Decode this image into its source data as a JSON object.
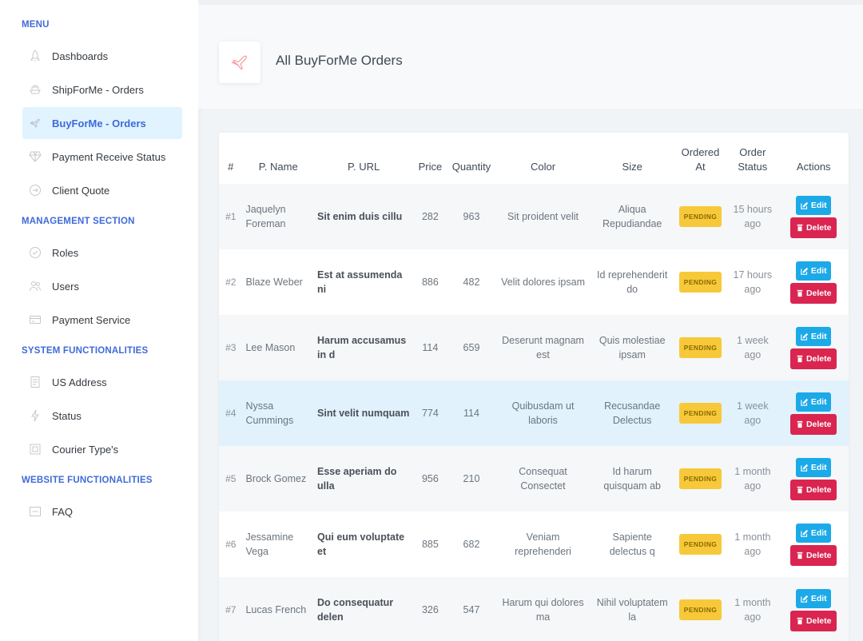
{
  "sidebar": {
    "sections": [
      {
        "heading": "MENU",
        "items": [
          {
            "label": "Dashboards",
            "icon": "rocket-icon",
            "active": false
          },
          {
            "label": "ShipForMe - Orders",
            "icon": "ship-icon",
            "active": false
          },
          {
            "label": "BuyForMe - Orders",
            "icon": "plane-icon",
            "active": true
          },
          {
            "label": "Payment Receive Status",
            "icon": "diamond-icon",
            "active": false
          },
          {
            "label": "Client Quote",
            "icon": "arrow-circle-icon",
            "active": false
          }
        ]
      },
      {
        "heading": "MANAGEMENT SECTION",
        "items": [
          {
            "label": "Roles",
            "icon": "check-circle-icon",
            "active": false
          },
          {
            "label": "Users",
            "icon": "users-icon",
            "active": false
          },
          {
            "label": "Payment Service",
            "icon": "credit-card-icon",
            "active": false
          }
        ]
      },
      {
        "heading": "SYSTEM FUNCTIONALITIES",
        "items": [
          {
            "label": "US Address",
            "icon": "document-icon",
            "active": false
          },
          {
            "label": "Status",
            "icon": "lightning-icon",
            "active": false
          },
          {
            "label": "Courier Type's",
            "icon": "box-icon",
            "active": false
          }
        ]
      },
      {
        "heading": "WEBSITE FUNCTIONALITIES",
        "items": [
          {
            "label": "FAQ",
            "icon": "list-box-icon",
            "active": false
          }
        ]
      }
    ]
  },
  "header": {
    "title": "All BuyForMe Orders",
    "icon": "plane-icon"
  },
  "table": {
    "columns": [
      "#",
      "P. Name",
      "P. URL",
      "Price",
      "Quantity",
      "Color",
      "Size",
      "Ordered At",
      "Order Status",
      "Actions"
    ],
    "edit_label": "Edit",
    "delete_label": "Delete",
    "rows": [
      {
        "num": "#1",
        "name": "Jaquelyn Foreman",
        "url": "Sit enim duis cillu",
        "price": "282",
        "quantity": "963",
        "color": "Sit proident velit",
        "size": "Aliqua Repudiandae",
        "status": "PENDING",
        "time": "15 hours ago"
      },
      {
        "num": "#2",
        "name": "Blaze Weber",
        "url": "Est at assumenda ni",
        "price": "886",
        "quantity": "482",
        "color": "Velit dolores ipsam",
        "size": "Id reprehenderit do",
        "status": "PENDING",
        "time": "17 hours ago"
      },
      {
        "num": "#3",
        "name": "Lee Mason",
        "url": "Harum accusamus in d",
        "price": "114",
        "quantity": "659",
        "color": "Deserunt magnam est",
        "size": "Quis molestiae ipsam",
        "status": "PENDING",
        "time": "1 week ago"
      },
      {
        "num": "#4",
        "name": "Nyssa Cummings",
        "url": "Sint velit numquam",
        "price": "774",
        "quantity": "114",
        "color": "Quibusdam ut laboris",
        "size": "Recusandae Delectus",
        "status": "PENDING",
        "time": "1 week ago"
      },
      {
        "num": "#5",
        "name": "Brock Gomez",
        "url": "Esse aperiam do ulla",
        "price": "956",
        "quantity": "210",
        "color": "Consequat Consectet",
        "size": "Id harum quisquam ab",
        "status": "PENDING",
        "time": "1 month ago"
      },
      {
        "num": "#6",
        "name": "Jessamine Vega",
        "url": "Qui eum voluptate et",
        "price": "885",
        "quantity": "682",
        "color": "Veniam reprehenderi",
        "size": "Sapiente delectus q",
        "status": "PENDING",
        "time": "1 month ago"
      },
      {
        "num": "#7",
        "name": "Lucas French",
        "url": "Do consequatur delen",
        "price": "326",
        "quantity": "547",
        "color": "Harum qui dolores ma",
        "size": "Nihil voluptatem la",
        "status": "PENDING",
        "time": "1 month ago"
      }
    ]
  },
  "colors": {
    "accent": "#3f6ad8",
    "active_bg": "#e0f3ff",
    "pending": "#f7c93a",
    "edit": "#1ca9e8",
    "delete": "#d92550"
  }
}
